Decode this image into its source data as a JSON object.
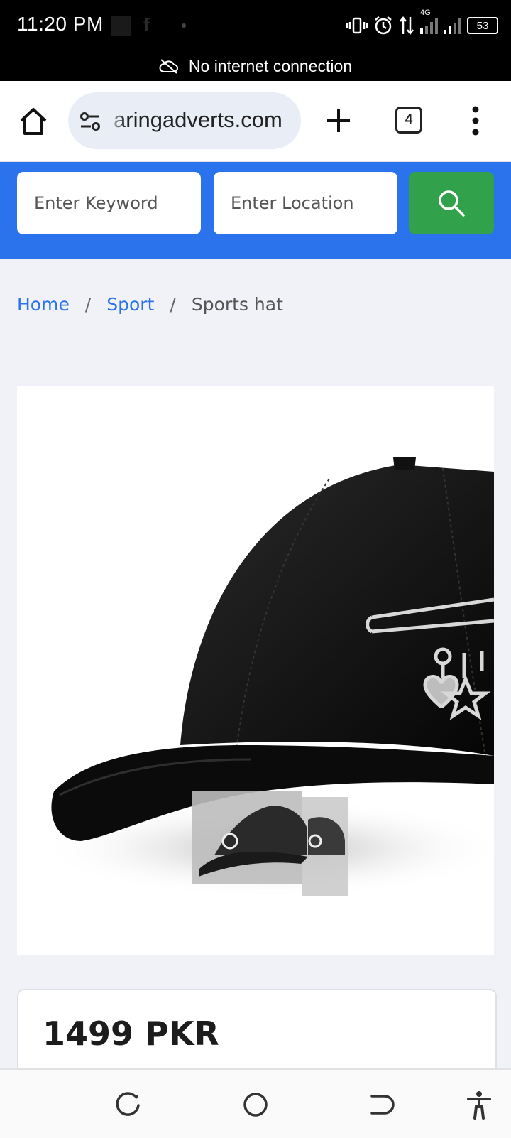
{
  "status_bar": {
    "time": "11:20 PM",
    "network": "4G",
    "battery": "53"
  },
  "offline_banner": {
    "text": "No internet connection"
  },
  "browser": {
    "url": "aringadverts.com",
    "tab_count": "4"
  },
  "search": {
    "keyword_placeholder": "Enter Keyword",
    "location_placeholder": "Enter Location"
  },
  "breadcrumb": {
    "home": "Home",
    "separator": "/",
    "category": "Sport",
    "current": "Sports hat"
  },
  "product": {
    "price": "1499 PKR"
  },
  "icons": {
    "home": "home-icon",
    "tune": "tune-icon",
    "plus": "plus-icon",
    "tabs": "tab-switcher-icon",
    "menu": "more-vert-icon",
    "search": "search-icon",
    "recents": "recents-icon",
    "home_nav": "home-circle-icon",
    "back": "back-icon",
    "accessibility": "accessibility-icon"
  },
  "colors": {
    "accent_blue": "#2b73ec",
    "search_green": "#31a14c"
  }
}
